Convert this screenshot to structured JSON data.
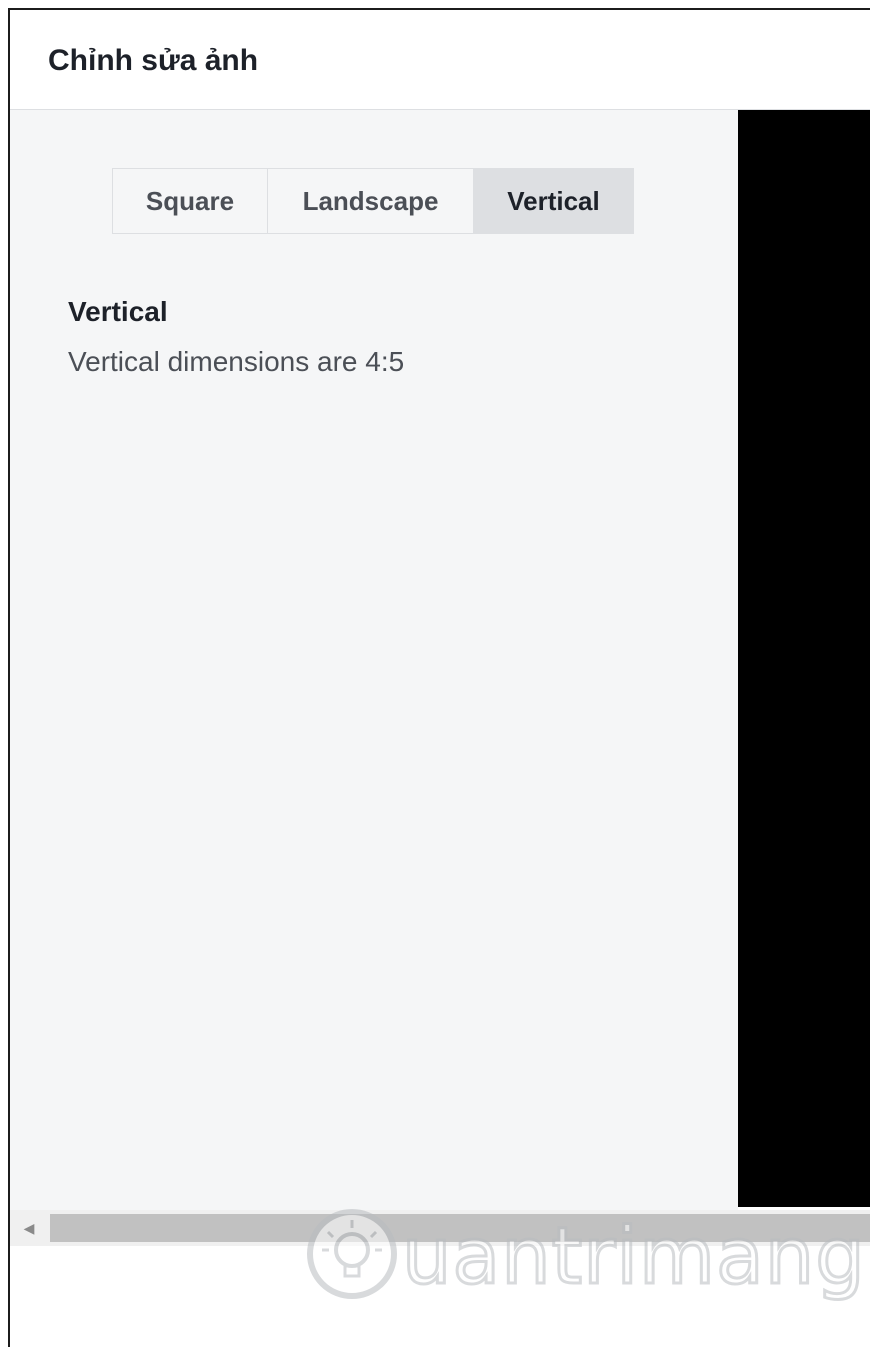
{
  "header": {
    "title": "Chỉnh sửa ảnh"
  },
  "crop_tabs": [
    {
      "label": "Square",
      "active": false
    },
    {
      "label": "Landscape",
      "active": false
    },
    {
      "label": "Vertical",
      "active": true
    }
  ],
  "selected_option": {
    "title": "Vertical",
    "description": "Vertical dimensions are 4:5"
  },
  "scrollbar": {
    "left_arrow_icon": "triangle-left-icon"
  },
  "watermark": {
    "text": "uantrimang",
    "icon": "lightbulb-icon"
  },
  "colors": {
    "panel_bg": "#f5f6f7",
    "active_tab_bg": "#dddfe2",
    "preview_bg": "#000000"
  }
}
